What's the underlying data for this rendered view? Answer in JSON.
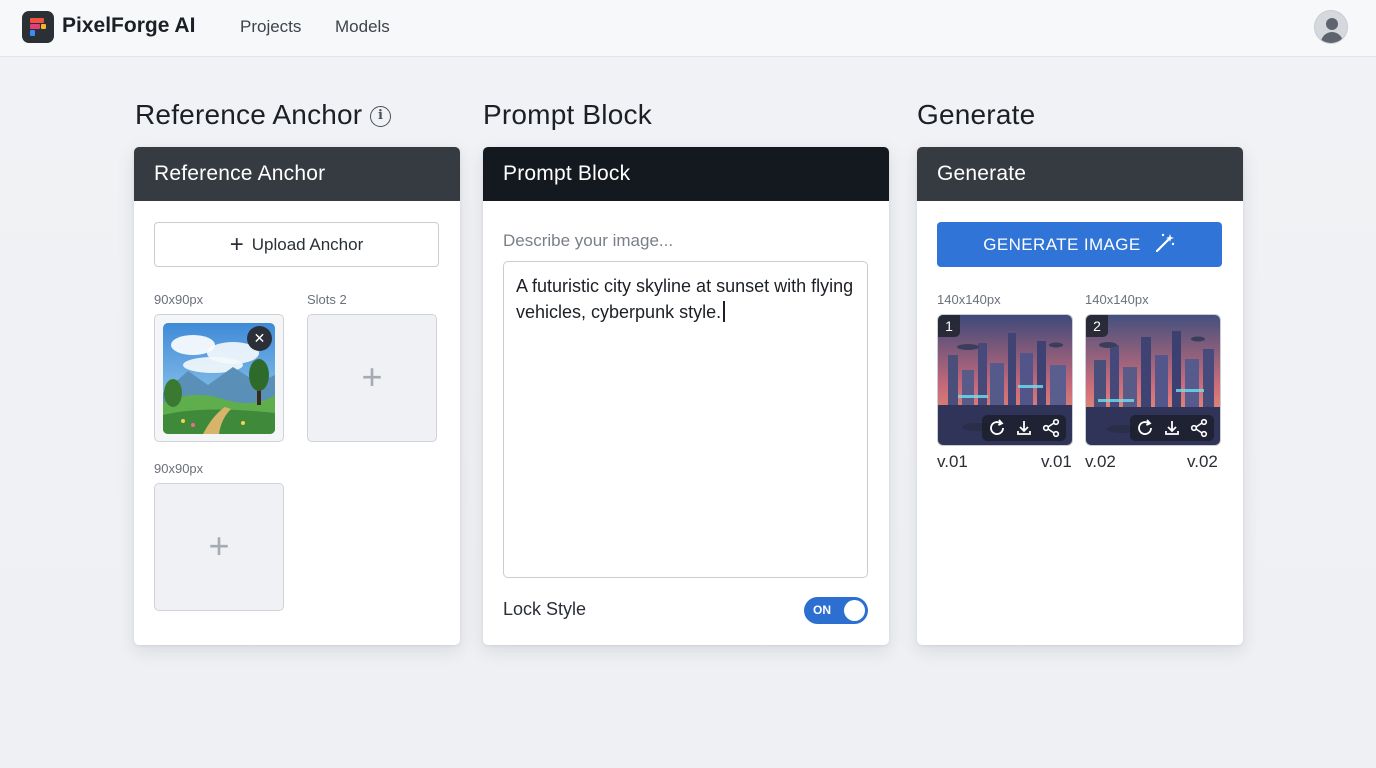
{
  "app": {
    "brand": "PixelForge AI",
    "nav": [
      "Projects",
      "Models"
    ]
  },
  "sections": {
    "reference": {
      "title": "Reference Anchor",
      "header": "Reference Anchor",
      "upload_label": "Upload Anchor",
      "slot1_label": "90x90px",
      "slot2_label": "Slots 2",
      "slot3_label": "90x90px",
      "remove_glyph": "✕",
      "add_glyph": "+"
    },
    "prompt": {
      "title": "Prompt Block",
      "header": "Prompt Block",
      "placeholder": "Describe your image...",
      "text": "A futuristic city skyline at sunset with flying vehicles, cyberpunk style.",
      "lock_label": "Lock Style",
      "toggle_state": "ON",
      "toggle_on": true
    },
    "generate": {
      "title": "Generate",
      "header": "Generate",
      "button_label": "GENERATE IMAGE",
      "results": [
        {
          "size_label": "140x140px",
          "index": "1",
          "version_left": "v.01",
          "version_right": "v.01"
        },
        {
          "size_label": "140x140px",
          "index": "2",
          "version_left": "v.02",
          "version_right": "v.02"
        }
      ]
    }
  },
  "colors": {
    "header_grey": "#363b42",
    "header_dark": "#141920",
    "primary_blue": "#2f74d6",
    "toggle_blue": "#2c6fd1"
  },
  "icons": [
    "logo-icon",
    "avatar-icon",
    "info-icon",
    "plus-icon",
    "close-icon",
    "magic-wand-icon",
    "refresh-icon",
    "download-icon",
    "share-icon"
  ]
}
